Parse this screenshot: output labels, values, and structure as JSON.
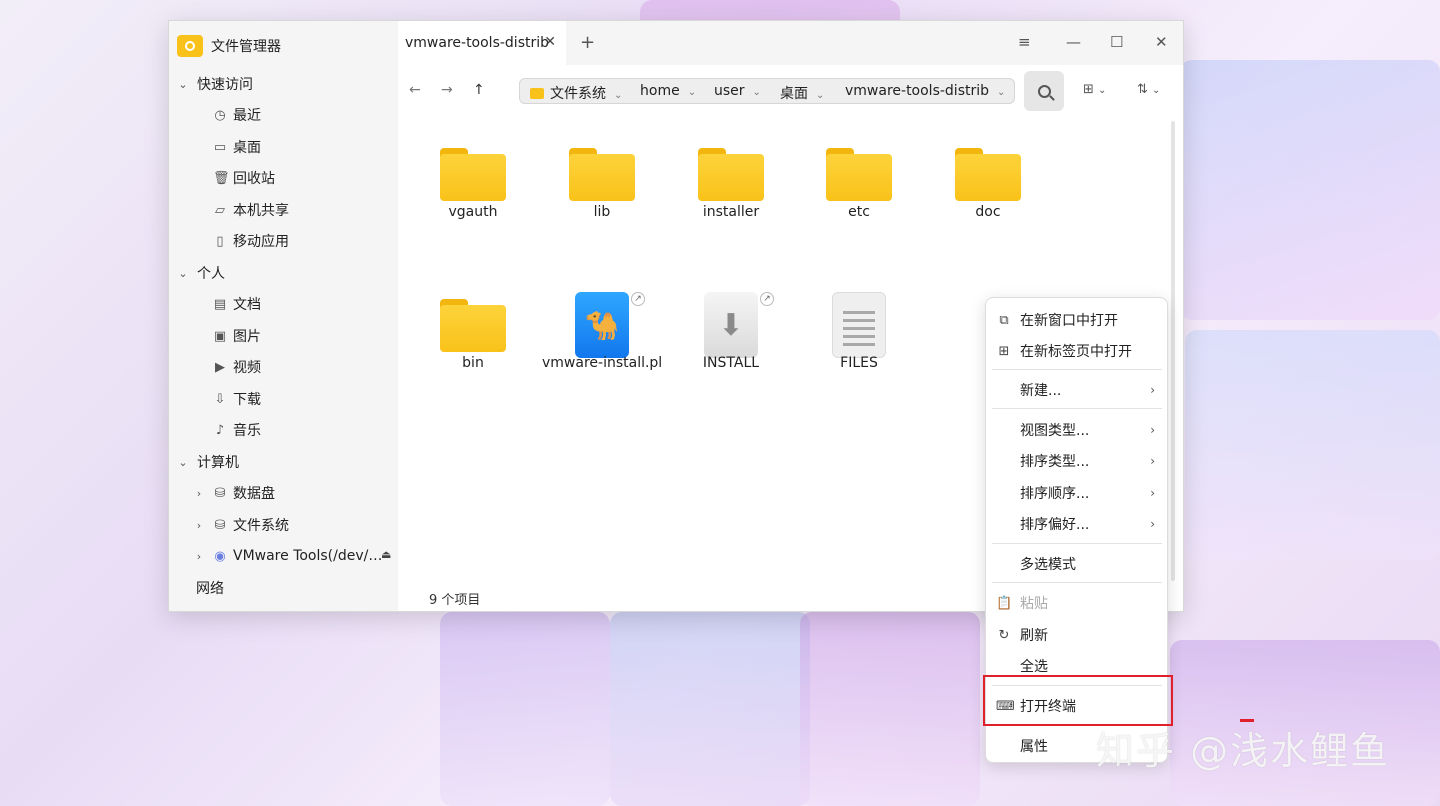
{
  "app": {
    "title": "文件管理器"
  },
  "sidebar": {
    "quick_access": "快速访问",
    "quick_items": [
      "最近",
      "桌面",
      "回收站",
      "本机共享",
      "移动应用"
    ],
    "personal": "个人",
    "personal_items": [
      "文档",
      "图片",
      "视频",
      "下载",
      "音乐"
    ],
    "computer": "计算机",
    "computer_items": [
      "数据盘",
      "文件系统",
      "VMware Tools(/dev/…"
    ],
    "network": "网络"
  },
  "tabs": [
    {
      "label": "vmware-tools-distrib"
    }
  ],
  "breadcrumb": [
    "文件系统",
    "home",
    "user",
    "桌面",
    "vmware-tools-distrib"
  ],
  "files": [
    {
      "name": "vgauth",
      "type": "folder"
    },
    {
      "name": "lib",
      "type": "folder"
    },
    {
      "name": "installer",
      "type": "folder"
    },
    {
      "name": "etc",
      "type": "folder"
    },
    {
      "name": "doc",
      "type": "folder"
    },
    {
      "name": "bin",
      "type": "folder"
    },
    {
      "name": "vmware-install.pl",
      "type": "script-link"
    },
    {
      "name": "INSTALL",
      "type": "installer-link"
    },
    {
      "name": "FILES",
      "type": "text"
    }
  ],
  "status": {
    "item_count": "9 个项目"
  },
  "context_menu": {
    "open_new_window": "在新窗口中打开",
    "open_new_tab": "在新标签页中打开",
    "new": "新建...",
    "view_type": "视图类型...",
    "sort_type": "排序类型...",
    "sort_order": "排序顺序...",
    "sort_pref": "排序偏好...",
    "multi_select": "多选模式",
    "paste": "粘贴",
    "refresh": "刷新",
    "select_all": "全选",
    "open_terminal": "打开终端",
    "properties": "属性"
  },
  "watermark": "知乎 @浅水鲤鱼",
  "colors": {
    "folder": "#f9c21a",
    "highlight": "#e0202a",
    "script_icon": "#1a8cff"
  }
}
